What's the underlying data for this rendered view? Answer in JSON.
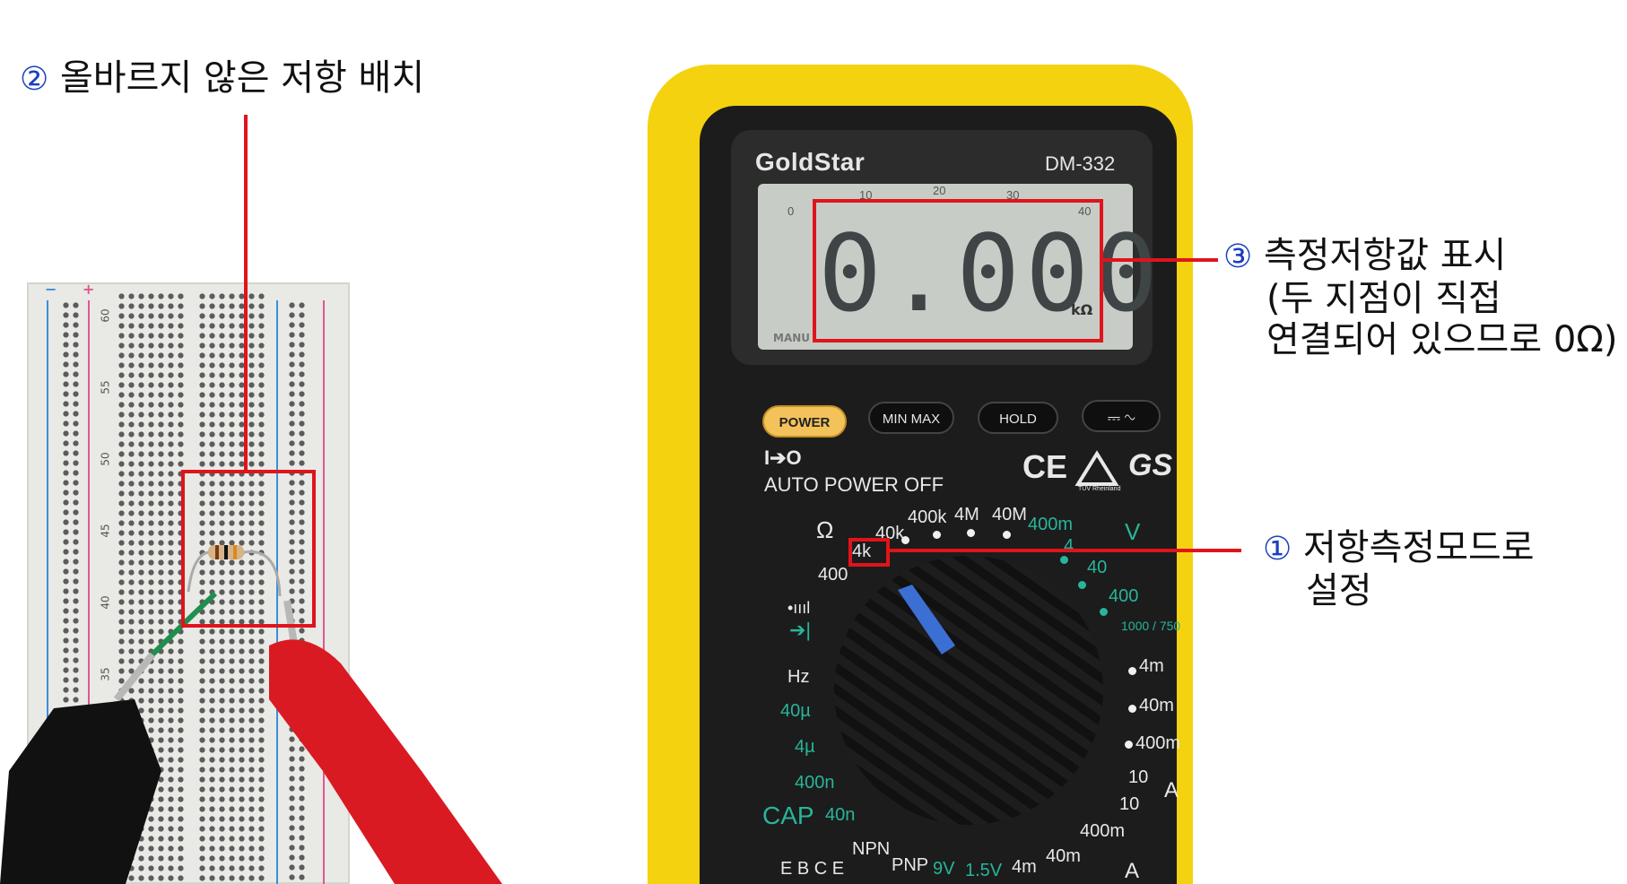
{
  "annotations": {
    "note2": {
      "number": "②",
      "text": "올바르지 않은 저항 배치"
    },
    "note3": {
      "number": "③",
      "lines": [
        "측정저항값 표시",
        "(두 지점이 직접",
        "연결되어 있으므로 0Ω)"
      ]
    },
    "note1": {
      "number": "①",
      "lines": [
        "저항측정모드로",
        "설정"
      ]
    }
  },
  "breadboard": {
    "row_numbers": [
      "60",
      "55",
      "50",
      "45",
      "40",
      "35"
    ],
    "rail_signs": {
      "minus": "−",
      "plus": "+"
    }
  },
  "multimeter": {
    "brand": "GoldStar",
    "model": "DM-332",
    "display": {
      "reading": "0.000",
      "unit": "kΩ",
      "scale_labels": [
        "0",
        "10",
        "20",
        "30",
        "40"
      ],
      "mode_label": "MANU"
    },
    "buttons": [
      "POWER",
      "MIN MAX",
      "HOLD",
      "⎓ ∿"
    ],
    "auto_power": {
      "symbol": "I➔O",
      "label": "AUTO POWER OFF"
    },
    "certifications": [
      "CE",
      "TÜV Rheinland",
      "GS"
    ],
    "dial_labels": {
      "ohm_symbol": "Ω",
      "ohm_ranges": [
        "400",
        "4k",
        "40k",
        "400k",
        "4M",
        "40M"
      ],
      "voltage_ranges": [
        "400m",
        "4",
        "40",
        "400",
        "1000 / 750"
      ],
      "voltage_symbol": "V",
      "current_ranges": [
        "4m",
        "40m",
        "400m",
        "10"
      ],
      "current_symbol": "A",
      "other_modes": [
        "Hz",
        "40µ",
        "4µ",
        "400n",
        "40n",
        "CAP"
      ],
      "bottom_row": [
        "E B C E",
        "NPN",
        "PNP",
        "9V",
        "1.5V",
        "4m",
        "40m",
        "400m"
      ],
      "ac_current_bottom": [
        "10",
        "A"
      ]
    }
  },
  "colors": {
    "annotation_red": "#e0141b",
    "annotation_number_blue": "#1a3fbf",
    "multimeter_case": "#f4d20f",
    "multimeter_body": "#1c1c1c",
    "dial_green": "#28b59a"
  }
}
